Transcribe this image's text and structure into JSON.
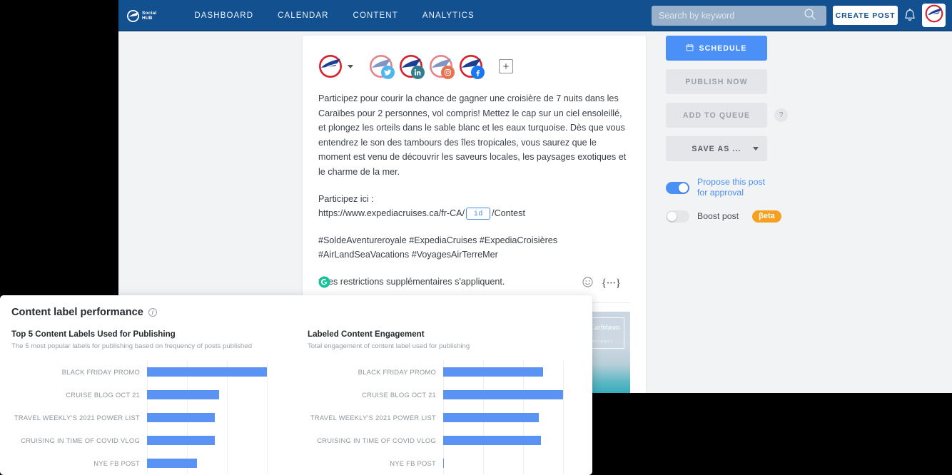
{
  "topnav": {
    "brand_line1": "Social",
    "brand_line2": "HUB",
    "links": [
      {
        "label": "DASHBOARD"
      },
      {
        "label": "CALENDAR"
      },
      {
        "label": "CONTENT"
      },
      {
        "label": "ANALYTICS"
      }
    ],
    "search_placeholder": "Search by keyword",
    "search_value": "",
    "create_post_label": "CREATE POST",
    "bg_color": "#12508f"
  },
  "composer": {
    "profiles": [
      {
        "network": "twitter",
        "selected": false
      },
      {
        "network": "linkedin",
        "selected": true
      },
      {
        "network": "instagram",
        "selected": false
      },
      {
        "network": "facebook",
        "selected": true
      }
    ],
    "add_profile_glyph": "+",
    "paragraph1": "Participez pour courir la chance de gagner une croisière de 7 nuits dans les Caraïbes pour 2 personnes, vol compris! Mettez le cap sur un ciel ensoleillé, et plongez les orteils dans le sable blanc et les eaux turquoise. Dès que vous entendrez le son des tambours des îles tropicales, vous saurez que le moment est venu de découvrir les saveurs locales, les paysages exotiques et le charme de la mer.",
    "link_intro": "Participez ici :",
    "link_prefix": "https://www.expediacruises.ca/fr-CA/",
    "link_token": "id",
    "link_suffix": "/Contest",
    "hashtags": "#SoldeAventureroyale #ExpediaCruises #ExpediaCroisières #AirLandSeaVacations #VoyagesAirTerreMer",
    "disclaimer": "*Des restrictions supplémentaires s'appliquent.",
    "emoji_glyph": "☺",
    "variable_glyph": "{···}",
    "media_watermark_name": "RoyalCaribbean",
    "media_watermark_sub": "INTERNATIONAL"
  },
  "actions": {
    "schedule_label": "SCHEDULE",
    "publish_now_label": "PUBLISH NOW",
    "add_to_queue_label": "ADD TO QUEUE",
    "help_glyph": "?",
    "save_as_label": "SAVE AS ...",
    "propose_label_line1": "Propose this post",
    "propose_label_line2": "for approval",
    "propose_on": true,
    "boost_label": "Boost post",
    "boost_badge": "βeta",
    "boost_on": false,
    "primary_color": "#4a90f7",
    "beta_color": "#f5a01e"
  },
  "analytics": {
    "title": "Content label performance",
    "chart_data": [
      {
        "type": "bar",
        "orientation": "horizontal",
        "title": "Top 5 Content Labels Used for Publishing",
        "subtitle": "The 5 most popular labels for publishing based on frequency of posts published",
        "categories": [
          "BLACK FRIDAY PROMO",
          "CRUISE BLOG OCT 21",
          "TRAVEL WEEKLY'S 2021 POWER LIST",
          "CRUISING IN TIME OF COVID VLOG",
          "NYE FB POST"
        ],
        "values": [
          3.0,
          1.8,
          1.7,
          1.7,
          1.25
        ],
        "xlabel": "",
        "ylabel": "",
        "xlim": [
          0,
          3.0
        ],
        "gridlines": [
          0,
          1,
          2,
          3
        ],
        "bar_color": "#5b93f5",
        "grid": true,
        "legend": "none"
      },
      {
        "type": "bar",
        "orientation": "horizontal",
        "title": "Labeled Content Engagement",
        "subtitle": "Total engagement of content label used for publishing",
        "categories": [
          "BLACK FRIDAY PROMO",
          "CRUISE BLOG OCT 21",
          "TRAVEL WEEKLY'S 2021 POWER LIST",
          "CRUISING IN TIME OF COVID VLOG",
          "NYE FB POST"
        ],
        "values": [
          2.5,
          3.0,
          2.4,
          2.45,
          0.02
        ],
        "xlabel": "",
        "ylabel": "",
        "xlim": [
          0,
          3.0
        ],
        "gridlines": [
          0,
          1,
          2,
          3
        ],
        "bar_color": "#5b93f5",
        "grid": true,
        "legend": "none"
      }
    ]
  }
}
